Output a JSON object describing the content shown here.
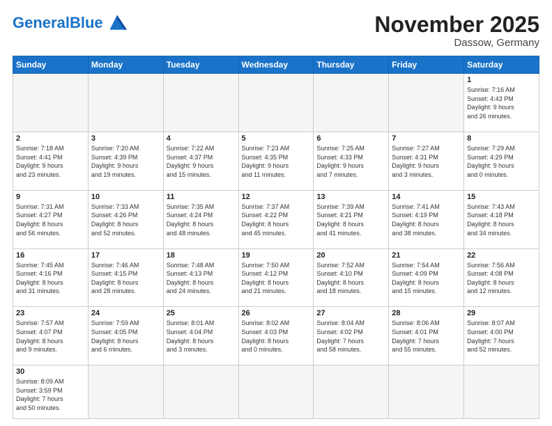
{
  "header": {
    "logo_general": "General",
    "logo_blue": "Blue",
    "month": "November 2025",
    "location": "Dassow, Germany"
  },
  "days_of_week": [
    "Sunday",
    "Monday",
    "Tuesday",
    "Wednesday",
    "Thursday",
    "Friday",
    "Saturday"
  ],
  "weeks": [
    [
      {
        "day": "",
        "info": ""
      },
      {
        "day": "",
        "info": ""
      },
      {
        "day": "",
        "info": ""
      },
      {
        "day": "",
        "info": ""
      },
      {
        "day": "",
        "info": ""
      },
      {
        "day": "",
        "info": ""
      },
      {
        "day": "1",
        "info": "Sunrise: 7:16 AM\nSunset: 4:43 PM\nDaylight: 9 hours\nand 26 minutes."
      }
    ],
    [
      {
        "day": "2",
        "info": "Sunrise: 7:18 AM\nSunset: 4:41 PM\nDaylight: 9 hours\nand 23 minutes."
      },
      {
        "day": "3",
        "info": "Sunrise: 7:20 AM\nSunset: 4:39 PM\nDaylight: 9 hours\nand 19 minutes."
      },
      {
        "day": "4",
        "info": "Sunrise: 7:22 AM\nSunset: 4:37 PM\nDaylight: 9 hours\nand 15 minutes."
      },
      {
        "day": "5",
        "info": "Sunrise: 7:23 AM\nSunset: 4:35 PM\nDaylight: 9 hours\nand 11 minutes."
      },
      {
        "day": "6",
        "info": "Sunrise: 7:25 AM\nSunset: 4:33 PM\nDaylight: 9 hours\nand 7 minutes."
      },
      {
        "day": "7",
        "info": "Sunrise: 7:27 AM\nSunset: 4:31 PM\nDaylight: 9 hours\nand 3 minutes."
      },
      {
        "day": "8",
        "info": "Sunrise: 7:29 AM\nSunset: 4:29 PM\nDaylight: 9 hours\nand 0 minutes."
      }
    ],
    [
      {
        "day": "9",
        "info": "Sunrise: 7:31 AM\nSunset: 4:27 PM\nDaylight: 8 hours\nand 56 minutes."
      },
      {
        "day": "10",
        "info": "Sunrise: 7:33 AM\nSunset: 4:26 PM\nDaylight: 8 hours\nand 52 minutes."
      },
      {
        "day": "11",
        "info": "Sunrise: 7:35 AM\nSunset: 4:24 PM\nDaylight: 8 hours\nand 48 minutes."
      },
      {
        "day": "12",
        "info": "Sunrise: 7:37 AM\nSunset: 4:22 PM\nDaylight: 8 hours\nand 45 minutes."
      },
      {
        "day": "13",
        "info": "Sunrise: 7:39 AM\nSunset: 4:21 PM\nDaylight: 8 hours\nand 41 minutes."
      },
      {
        "day": "14",
        "info": "Sunrise: 7:41 AM\nSunset: 4:19 PM\nDaylight: 8 hours\nand 38 minutes."
      },
      {
        "day": "15",
        "info": "Sunrise: 7:43 AM\nSunset: 4:18 PM\nDaylight: 8 hours\nand 34 minutes."
      }
    ],
    [
      {
        "day": "16",
        "info": "Sunrise: 7:45 AM\nSunset: 4:16 PM\nDaylight: 8 hours\nand 31 minutes."
      },
      {
        "day": "17",
        "info": "Sunrise: 7:46 AM\nSunset: 4:15 PM\nDaylight: 8 hours\nand 28 minutes."
      },
      {
        "day": "18",
        "info": "Sunrise: 7:48 AM\nSunset: 4:13 PM\nDaylight: 8 hours\nand 24 minutes."
      },
      {
        "day": "19",
        "info": "Sunrise: 7:50 AM\nSunset: 4:12 PM\nDaylight: 8 hours\nand 21 minutes."
      },
      {
        "day": "20",
        "info": "Sunrise: 7:52 AM\nSunset: 4:10 PM\nDaylight: 8 hours\nand 18 minutes."
      },
      {
        "day": "21",
        "info": "Sunrise: 7:54 AM\nSunset: 4:09 PM\nDaylight: 8 hours\nand 15 minutes."
      },
      {
        "day": "22",
        "info": "Sunrise: 7:56 AM\nSunset: 4:08 PM\nDaylight: 8 hours\nand 12 minutes."
      }
    ],
    [
      {
        "day": "23",
        "info": "Sunrise: 7:57 AM\nSunset: 4:07 PM\nDaylight: 8 hours\nand 9 minutes."
      },
      {
        "day": "24",
        "info": "Sunrise: 7:59 AM\nSunset: 4:05 PM\nDaylight: 8 hours\nand 6 minutes."
      },
      {
        "day": "25",
        "info": "Sunrise: 8:01 AM\nSunset: 4:04 PM\nDaylight: 8 hours\nand 3 minutes."
      },
      {
        "day": "26",
        "info": "Sunrise: 8:02 AM\nSunset: 4:03 PM\nDaylight: 8 hours\nand 0 minutes."
      },
      {
        "day": "27",
        "info": "Sunrise: 8:04 AM\nSunset: 4:02 PM\nDaylight: 7 hours\nand 58 minutes."
      },
      {
        "day": "28",
        "info": "Sunrise: 8:06 AM\nSunset: 4:01 PM\nDaylight: 7 hours\nand 55 minutes."
      },
      {
        "day": "29",
        "info": "Sunrise: 8:07 AM\nSunset: 4:00 PM\nDaylight: 7 hours\nand 52 minutes."
      }
    ],
    [
      {
        "day": "30",
        "info": "Sunrise: 8:09 AM\nSunset: 3:59 PM\nDaylight: 7 hours\nand 50 minutes."
      },
      {
        "day": "",
        "info": ""
      },
      {
        "day": "",
        "info": ""
      },
      {
        "day": "",
        "info": ""
      },
      {
        "day": "",
        "info": ""
      },
      {
        "day": "",
        "info": ""
      },
      {
        "day": "",
        "info": ""
      }
    ]
  ]
}
